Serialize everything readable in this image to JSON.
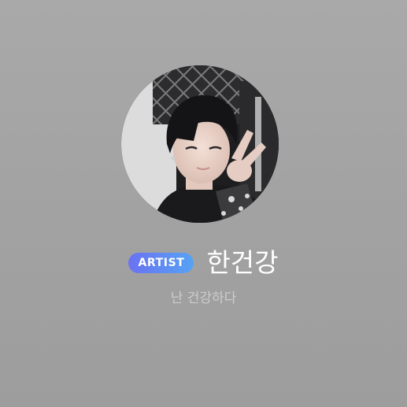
{
  "profile": {
    "badge_label": "ARTIST",
    "name": "한건강",
    "status_message": "난 건강하다"
  },
  "colors": {
    "background": "#a6a6a6",
    "badge_gradient_start": "#6a72f2",
    "badge_gradient_end": "#56a3f4",
    "name_text": "#ffffff",
    "status_text": "#cdcdcd"
  }
}
